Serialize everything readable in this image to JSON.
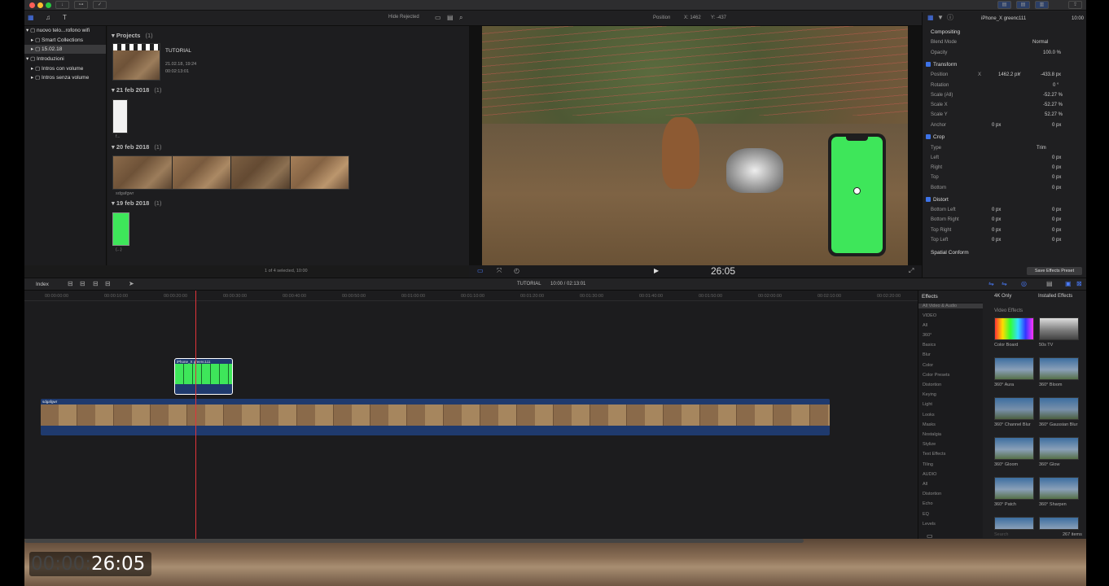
{
  "toolbar": {
    "filter": "Hide Rejected",
    "viewer_position_label": "Position",
    "viewer_position_x": "X: 1462",
    "viewer_position_y": "Y: -437",
    "inspector_clip_name": "iPhone_X greenc111",
    "inspector_time": "10:00"
  },
  "library": {
    "items": [
      {
        "label": "nuovo telo...rofono wifi",
        "level": 0
      },
      {
        "label": "Smart Collections",
        "level": 1
      },
      {
        "label": "15.02.18",
        "level": 1,
        "selected": true
      },
      {
        "label": "Introduzioni",
        "level": 0
      },
      {
        "label": "Intros con volume",
        "level": 1
      },
      {
        "label": "Intros senza volume",
        "level": 1
      }
    ]
  },
  "browser": {
    "projects_label": "Projects",
    "projects_count": "(1)",
    "project_name": "TUTORIAL",
    "project_date": "21.02.18, 19:24",
    "project_duration": "00:02:13:01",
    "groups": [
      {
        "label": "21 feb 2018",
        "count": "(1)"
      },
      {
        "label": "20 feb 2018",
        "count": "(1)"
      },
      {
        "label": "19 feb 2018",
        "count": "(1)"
      }
    ],
    "clip_label_1": "f...",
    "clip_label_2": "sdgafgwr",
    "clip_label_3": "(...)",
    "status": "1 of 4 selected, 10:00"
  },
  "viewer": {
    "timecode": "26:05"
  },
  "inspector": {
    "compositing": "Compositing",
    "blend_mode_label": "Blend Mode",
    "blend_mode_value": "Normal",
    "opacity_label": "Opacity",
    "opacity_value": "100.0 %",
    "transform": "Transform",
    "position_label": "Position",
    "position_x_label": "X",
    "position_x": "1462.2 px",
    "position_y_label": "Y",
    "position_y": "-433.8 px",
    "rotation_label": "Rotation",
    "rotation_value": "0 °",
    "scale_all_label": "Scale (All)",
    "scale_all_value": "-52.27 %",
    "scale_x_label": "Scale X",
    "scale_x_value": "-52.27 %",
    "scale_y_label": "Scale Y",
    "scale_y_value": "52.27 %",
    "anchor_label": "Anchor",
    "anchor_x": "0 px",
    "anchor_y": "0 px",
    "crop": "Crop",
    "type_label": "Type",
    "type_value": "Trim",
    "left_label": "Left",
    "left_value": "0 px",
    "right_label": "Right",
    "right_value": "0 px",
    "top_label": "Top",
    "top_value": "0 px",
    "bottom_label": "Bottom",
    "bottom_value": "0 px",
    "distort": "Distort",
    "bottom_left": "Bottom Left",
    "bottom_right": "Bottom Right",
    "top_right": "Top Right",
    "top_left": "Top Left",
    "zero_px": "0 px",
    "spatial_conform": "Spatial Conform",
    "save_preset": "Save Effects Preset"
  },
  "timeline": {
    "index": "Index",
    "project": "TUTORIAL",
    "position": "10:00 / 02:13:01",
    "ticks": [
      "00:00:00:00",
      "00:00:10:00",
      "00:00:20:00",
      "00:00:30:00",
      "00:00:40:00",
      "00:00:50:00",
      "00:01:00:00",
      "00:01:10:00",
      "00:01:20:00",
      "00:01:30:00",
      "00:01:40:00",
      "00:01:50:00",
      "00:02:00:00",
      "00:02:10:00",
      "00:02:20:00"
    ],
    "connected_clip": "iPhone_X greenc111",
    "main_clip": "sdgafgwr"
  },
  "effects": {
    "title": "Effects",
    "filter": "4K Only",
    "installed": "Installed Effects",
    "section": "Video Effects",
    "categories": [
      "All Video & Audio",
      "VIDEO",
      "All",
      "360°",
      "Basics",
      "Blur",
      "Color",
      "Color Presets",
      "Distortion",
      "Keying",
      "Light",
      "Looks",
      "Masks",
      "Nostalgia",
      "Stylize",
      "Text Effects",
      "Tiling",
      "AUDIO",
      "All",
      "Distortion",
      "Echo",
      "EQ",
      "Levels"
    ],
    "items": [
      "Color Board",
      "50s TV",
      "360° Aura",
      "360° Bloom",
      "360° Channel Blur",
      "360° Gaussian Blur",
      "360° Gloom",
      "360° Glow",
      "360° Patch",
      "360° Sharpen"
    ],
    "search": "Search",
    "count": "267 items"
  },
  "overlay": {
    "tc_dim": "00:00:",
    "tc_on": "26:05"
  }
}
